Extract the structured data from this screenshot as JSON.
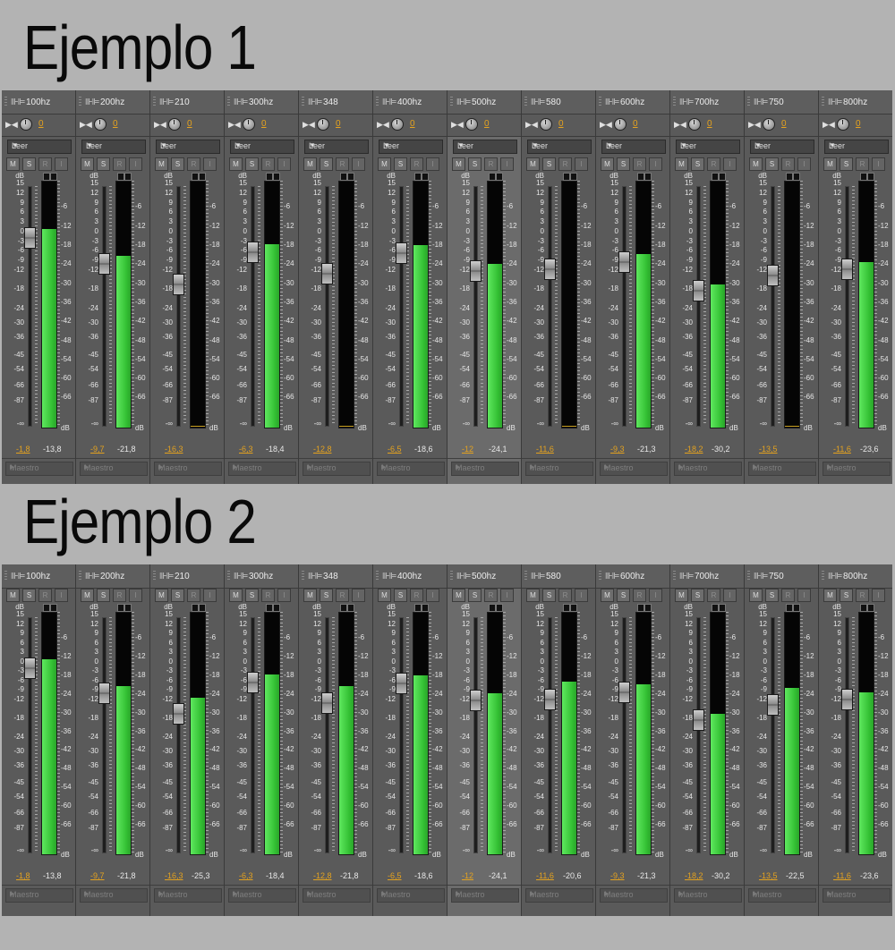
{
  "examples": [
    {
      "title": "Ejemplo 1",
      "show_read_row": true,
      "channels": [
        {
          "name": "100hz",
          "pan": "0",
          "read": "Leer",
          "m": "M",
          "s": "S",
          "r": "R",
          "i": "I",
          "volume": "-1,8",
          "peak": "-13,8",
          "meter_db": -13.8,
          "fader_db": -1.8,
          "output": "Maestro",
          "selected": false
        },
        {
          "name": "200hz",
          "pan": "0",
          "read": "Leer",
          "m": "M",
          "s": "S",
          "r": "R",
          "i": "I",
          "volume": "-9,7",
          "peak": "-21,8",
          "meter_db": -21.8,
          "fader_db": -9.7,
          "output": "Maestro",
          "selected": false
        },
        {
          "name": "210",
          "pan": "0",
          "read": "Leer",
          "m": "M",
          "s": "S",
          "r": "R",
          "i": "I",
          "volume": "-16,3",
          "peak": "",
          "meter_db": null,
          "fader_db": -16.3,
          "output": "Maestro",
          "selected": false
        },
        {
          "name": "300hz",
          "pan": "0",
          "read": "Leer",
          "m": "M",
          "s": "S",
          "r": "R",
          "i": "I",
          "volume": "-6,3",
          "peak": "-18,4",
          "meter_db": -18.4,
          "fader_db": -6.3,
          "output": "Maestro",
          "selected": false
        },
        {
          "name": "348",
          "pan": "0",
          "read": "Leer",
          "m": "M",
          "s": "S",
          "r": "R",
          "i": "I",
          "volume": "-12,8",
          "peak": "",
          "meter_db": null,
          "fader_db": -12.8,
          "output": "Maestro",
          "selected": false
        },
        {
          "name": "400hz",
          "pan": "0",
          "read": "Leer",
          "m": "M",
          "s": "S",
          "r": "R",
          "i": "I",
          "volume": "-6,5",
          "peak": "-18,6",
          "meter_db": -18.6,
          "fader_db": -6.5,
          "output": "Maestro",
          "selected": false
        },
        {
          "name": "500hz",
          "pan": "0",
          "read": "Leer",
          "m": "M",
          "s": "S",
          "r": "R",
          "i": "I",
          "volume": "-12",
          "peak": "-24,1",
          "meter_db": -24.1,
          "fader_db": -12,
          "output": "Maestro",
          "selected": true
        },
        {
          "name": "580",
          "pan": "0",
          "read": "Leer",
          "m": "M",
          "s": "S",
          "r": "R",
          "i": "I",
          "volume": "-11,6",
          "peak": "",
          "meter_db": null,
          "fader_db": -11.6,
          "output": "Maestro",
          "selected": false
        },
        {
          "name": "600hz",
          "pan": "0",
          "read": "Leer",
          "m": "M",
          "s": "S",
          "r": "R",
          "i": "I",
          "volume": "-9,3",
          "peak": "-21,3",
          "meter_db": -21.3,
          "fader_db": -9.3,
          "output": "Maestro",
          "selected": false
        },
        {
          "name": "700hz",
          "pan": "0",
          "read": "Leer",
          "m": "M",
          "s": "S",
          "r": "R",
          "i": "I",
          "volume": "-18,2",
          "peak": "-30,2",
          "meter_db": -30.2,
          "fader_db": -18.2,
          "output": "Maestro",
          "selected": false
        },
        {
          "name": "750",
          "pan": "0",
          "read": "Leer",
          "m": "M",
          "s": "S",
          "r": "R",
          "i": "I",
          "volume": "-13,5",
          "peak": "",
          "meter_db": null,
          "fader_db": -13.5,
          "output": "Maestro",
          "selected": false
        },
        {
          "name": "800hz",
          "pan": "0",
          "read": "Leer",
          "m": "M",
          "s": "S",
          "r": "R",
          "i": "I",
          "volume": "-11,6",
          "peak": "-23,6",
          "meter_db": -23.6,
          "fader_db": -11.6,
          "output": "Maestro",
          "selected": false
        }
      ]
    },
    {
      "title": "Ejemplo 2",
      "show_read_row": false,
      "channels": [
        {
          "name": "100hz",
          "m": "M",
          "s": "S",
          "r": "R",
          "i": "I",
          "volume": "-1,8",
          "peak": "-13,8",
          "meter_db": -13.8,
          "fader_db": -1.8,
          "output": "Maestro",
          "selected": false
        },
        {
          "name": "200hz",
          "m": "M",
          "s": "S",
          "r": "R",
          "i": "I",
          "volume": "-9,7",
          "peak": "-21,8",
          "meter_db": -21.8,
          "fader_db": -9.7,
          "output": "Maestro",
          "selected": false
        },
        {
          "name": "210",
          "m": "M",
          "s": "S",
          "r": "R",
          "i": "I",
          "volume": "-16,3",
          "peak": "-25,3",
          "meter_db": -25.3,
          "fader_db": -16.3,
          "output": "Maestro",
          "selected": false
        },
        {
          "name": "300hz",
          "m": "M",
          "s": "S",
          "r": "R",
          "i": "I",
          "volume": "-6,3",
          "peak": "-18,4",
          "meter_db": -18.4,
          "fader_db": -6.3,
          "output": "Maestro",
          "selected": false
        },
        {
          "name": "348",
          "m": "M",
          "s": "S",
          "r": "R",
          "i": "I",
          "volume": "-12,8",
          "peak": "-21,8",
          "meter_db": -21.8,
          "fader_db": -12.8,
          "output": "Maestro",
          "selected": false
        },
        {
          "name": "400hz",
          "m": "M",
          "s": "S",
          "r": "R",
          "i": "I",
          "volume": "-6,5",
          "peak": "-18,6",
          "meter_db": -18.6,
          "fader_db": -6.5,
          "output": "Maestro",
          "selected": false
        },
        {
          "name": "500hz",
          "m": "M",
          "s": "S",
          "r": "R",
          "i": "I",
          "volume": "-12",
          "peak": "-24,1",
          "meter_db": -24.1,
          "fader_db": -12,
          "output": "Maestro",
          "selected": true
        },
        {
          "name": "580",
          "m": "M",
          "s": "S",
          "r": "R",
          "i": "I",
          "volume": "-11,6",
          "peak": "-20,6",
          "meter_db": -20.6,
          "fader_db": -11.6,
          "output": "Maestro",
          "selected": false
        },
        {
          "name": "600hz",
          "m": "M",
          "s": "S",
          "r": "R",
          "i": "I",
          "volume": "-9,3",
          "peak": "-21,3",
          "meter_db": -21.3,
          "fader_db": -9.3,
          "output": "Maestro",
          "selected": false
        },
        {
          "name": "700hz",
          "m": "M",
          "s": "S",
          "r": "R",
          "i": "I",
          "volume": "-18,2",
          "peak": "-30,2",
          "meter_db": -30.2,
          "fader_db": -18.2,
          "output": "Maestro",
          "selected": false
        },
        {
          "name": "750",
          "m": "M",
          "s": "S",
          "r": "R",
          "i": "I",
          "volume": "-13,5",
          "peak": "-22,5",
          "meter_db": -22.5,
          "fader_db": -13.5,
          "output": "Maestro",
          "selected": false
        },
        {
          "name": "800hz",
          "m": "M",
          "s": "S",
          "r": "R",
          "i": "I",
          "volume": "-11,6",
          "peak": "-23,6",
          "meter_db": -23.6,
          "fader_db": -11.6,
          "output": "Maestro",
          "selected": false
        }
      ]
    }
  ],
  "fader_scale": [
    "dB",
    "15",
    "12",
    "9",
    "6",
    "3",
    "0",
    "-3",
    "-6",
    "-9",
    "-12",
    "-18",
    "-24",
    "-30",
    "-36",
    "-45",
    "-54",
    "-66",
    "-87",
    "-∞"
  ],
  "meter_scale": [
    "-6",
    "-12",
    "-18",
    "-24",
    "-30",
    "-36",
    "-42",
    "-48",
    "-54",
    "-60",
    "-66",
    "dB"
  ],
  "colors": {
    "meter_green": "#3fd23f",
    "value_orange": "#e4a21f",
    "strip_bg": "#5a5a5a",
    "selected_strip_bg": "#6b6b6b"
  },
  "icons": {
    "channel": "waveform-icon",
    "pan_mode": "bowtie-icon",
    "pan": "knob-icon",
    "read_dropdown": "chevron-down-icon",
    "output_dropdown": "chevron-right-icon"
  }
}
